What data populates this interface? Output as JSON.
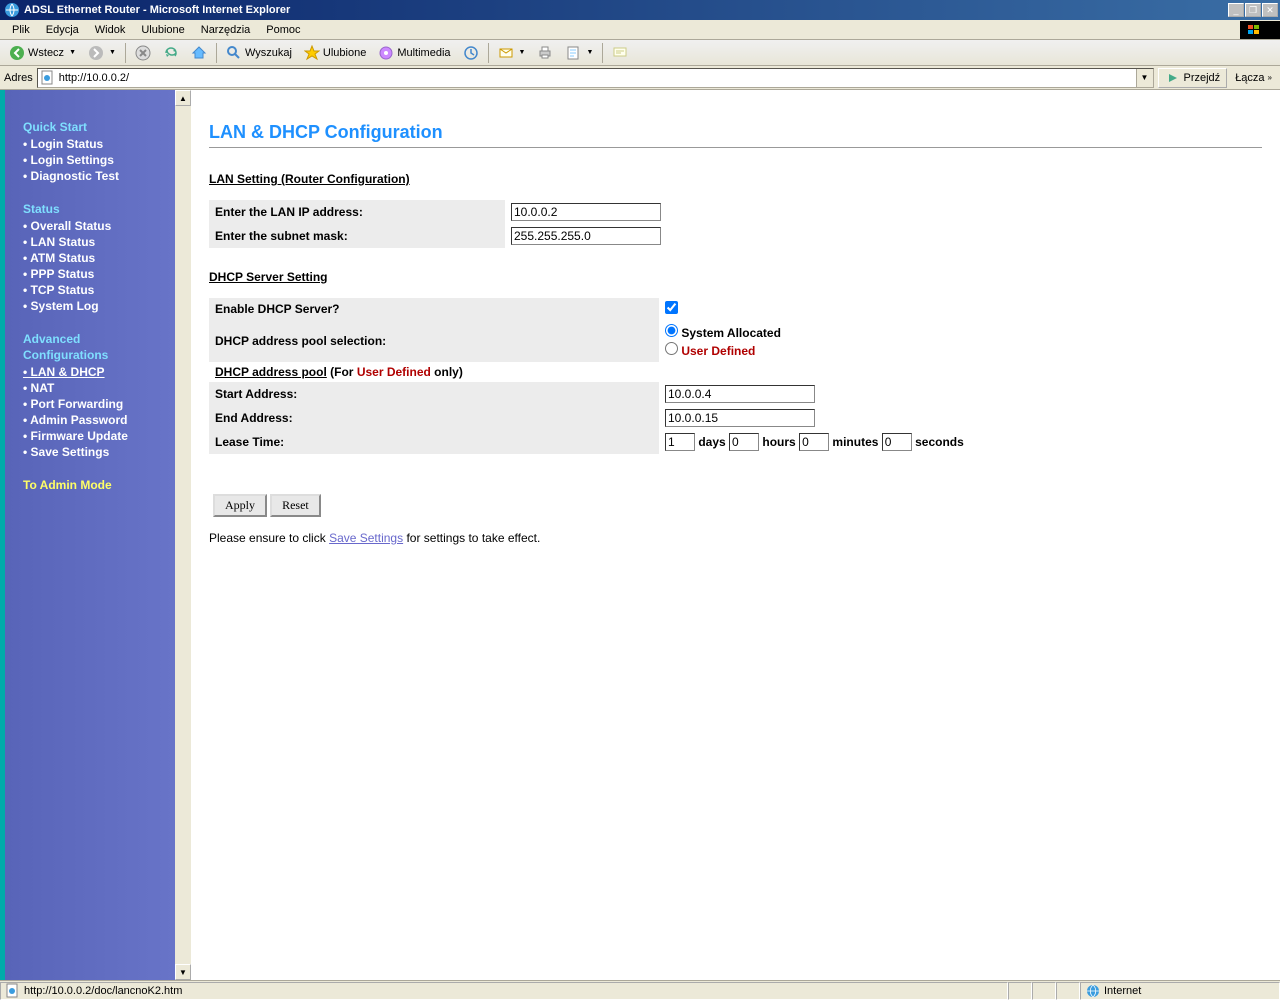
{
  "window": {
    "title": "ADSL Ethernet Router - Microsoft Internet Explorer"
  },
  "menubar": {
    "items": [
      "Plik",
      "Edycja",
      "Widok",
      "Ulubione",
      "Narzędzia",
      "Pomoc"
    ]
  },
  "toolbar": {
    "back": "Wstecz",
    "search": "Wyszukaj",
    "favorites": "Ulubione",
    "media": "Multimedia"
  },
  "addressbar": {
    "label": "Adres",
    "url": "http://10.0.0.2/",
    "go": "Przejdź",
    "links": "Łącza"
  },
  "sidebar": {
    "quick_start": {
      "heading": "Quick Start",
      "items": [
        "Login Status",
        "Login Settings",
        "Diagnostic Test"
      ]
    },
    "status": {
      "heading": "Status",
      "items": [
        "Overall Status",
        "LAN Status",
        "ATM Status",
        "PPP Status",
        "TCP Status",
        "System Log"
      ]
    },
    "advanced": {
      "heading_l1": "Advanced",
      "heading_l2": "Configurations",
      "items": [
        "LAN & DHCP",
        "NAT",
        "Port Forwarding",
        "Admin Password",
        "Firmware Update",
        "Save Settings"
      ]
    },
    "admin": "To Admin Mode"
  },
  "page": {
    "title": "LAN & DHCP Configuration",
    "lan_section": "LAN Setting (Router Configuration)",
    "lan_ip_label": "Enter the LAN IP address:",
    "lan_ip_value": "10.0.0.2",
    "subnet_label": "Enter the subnet mask:",
    "subnet_value": "255.255.255.0",
    "dhcp_section": "DHCP Server Setting",
    "enable_dhcp_label": "Enable DHCP Server?",
    "pool_sel_label": "DHCP address pool selection:",
    "pool_sys": "System Allocated",
    "pool_user": "User Defined",
    "pool_head_b": "DHCP address pool",
    "pool_head_mid": " (For ",
    "pool_head_red": "User Defined",
    "pool_head_end": " only)",
    "start_label": "Start Address:",
    "start_value": "10.0.0.4",
    "end_label": "End Address:",
    "end_value": "10.0.0.15",
    "lease_label": "Lease Time:",
    "lease_days": "1",
    "lease_hours": "0",
    "lease_minutes": "0",
    "lease_seconds": "0",
    "unit_days": "days",
    "unit_hours": "hours",
    "unit_minutes": "minutes",
    "unit_seconds": "seconds",
    "apply": "Apply",
    "reset": "Reset",
    "note_pre": "Please ensure to click ",
    "note_link": "Save Settings",
    "note_post": " for settings to take effect."
  },
  "statusbar": {
    "text": "http://10.0.0.2/doc/lancnoK2.htm",
    "zone": "Internet"
  }
}
